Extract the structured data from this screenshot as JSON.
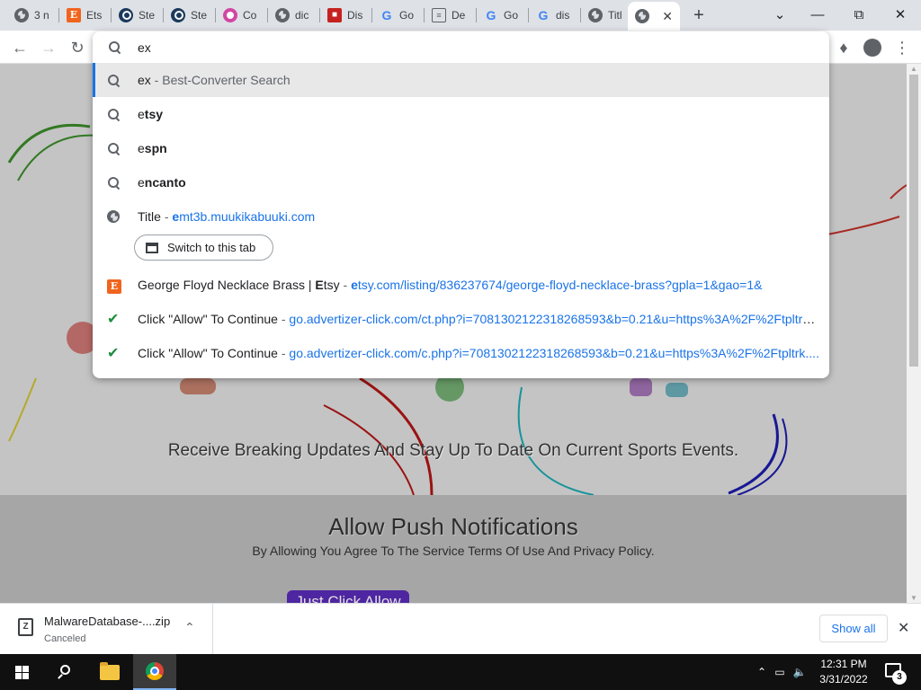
{
  "tabs": [
    {
      "title": "3 n",
      "icon": "globe-icon"
    },
    {
      "title": "Ets",
      "icon": "etsy-icon"
    },
    {
      "title": "Ste",
      "icon": "steam-icon"
    },
    {
      "title": "Ste",
      "icon": "steam-icon"
    },
    {
      "title": "Co",
      "icon": "photos-icon"
    },
    {
      "title": "dic",
      "icon": "globe-icon"
    },
    {
      "title": "Dis",
      "icon": "gift-icon"
    },
    {
      "title": "Go",
      "icon": "google-icon"
    },
    {
      "title": "De",
      "icon": "document-icon"
    },
    {
      "title": "Go",
      "icon": "google-icon"
    },
    {
      "title": "dis",
      "icon": "google-icon"
    },
    {
      "title": "Titl",
      "icon": "globe-icon"
    }
  ],
  "omnibox": {
    "query": "ex",
    "suggestions": [
      {
        "icon": "search-icon",
        "main": "ex",
        "sep": " - ",
        "detail": "Best-Converter Search",
        "detail_style": "dim"
      },
      {
        "icon": "search-icon",
        "prefix": "e",
        "rest": "tsy"
      },
      {
        "icon": "search-icon",
        "prefix": "e",
        "rest": "spn"
      },
      {
        "icon": "search-icon",
        "prefix": "e",
        "rest": "ncanto"
      },
      {
        "icon": "globe-icon",
        "title": "Title",
        "sep": " - ",
        "url_prefix": "e",
        "url_rest": "mt3b.muukikabuuki.com"
      },
      {
        "icon": "etsy-icon",
        "title_a": "George Floyd Necklace Brass | ",
        "title_b": "E",
        "title_c": "tsy",
        "sep": " - ",
        "url_prefix": "e",
        "url_rest": "tsy.com/listing/836237674/george-floyd-necklace-brass?gpla=1&gao=1&"
      },
      {
        "icon": "check-icon",
        "title": "Click \"Allow\" To Continue",
        "sep": " - ",
        "url": "go.advertizer-click.com/ct.php?i=7081302122318268593&b=0.21&u=https%3A%2F%2Ftpltrk...."
      },
      {
        "icon": "check-icon",
        "title": "Click \"Allow\" To Continue",
        "sep": " - ",
        "url": "go.advertizer-click.com/c.php?i=7081302122318268593&b=0.21&u=https%3A%2F%2Ftpltrk...."
      }
    ],
    "switch_tab_label": "Switch to this tab"
  },
  "page": {
    "headline": "Receive Breaking Updates And Stay Up To Date On Current Sports Events.",
    "title": "Allow Push Notifications",
    "subtitle": "By Allowing You Agree To The Service Terms Of Use And Privacy Policy.",
    "cta": "Just Click Allow"
  },
  "downloads": {
    "file_name": "MalwareDatabase-....zip",
    "status": "Canceled",
    "show_all": "Show all"
  },
  "taskbar": {
    "time": "12:31 PM",
    "date": "3/31/2022",
    "notification_count": "3"
  },
  "colors": {
    "accent": "#1a73e8",
    "cta_bg": "#5b2cb8",
    "check": "#1e8e3e",
    "etsy": "#f1641e"
  }
}
